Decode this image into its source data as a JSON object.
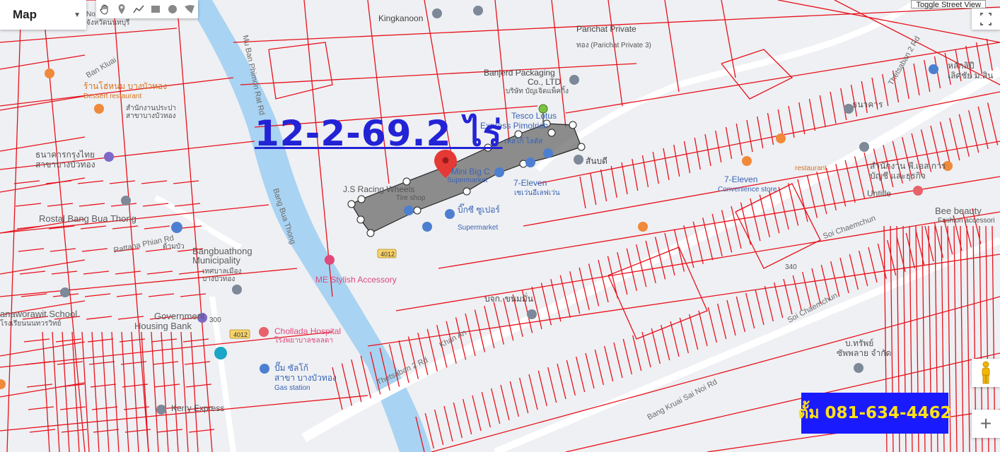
{
  "controls": {
    "map_type": "Map",
    "street_view_button": "Toggle Street View",
    "zoom_in": "+",
    "tools": [
      "hand-icon",
      "marker-icon",
      "polyline-icon",
      "rectangle-icon",
      "circle-icon",
      "polygon-icon"
    ]
  },
  "overlay": {
    "area_label": "12-2-69.2 ไร่",
    "contact": "ตั้ม 081-634-4462",
    "contact_bg": "#1a1aff",
    "contact_fg": "#ffe11a",
    "label_color": "#2323d6"
  },
  "colors": {
    "parcel_lines": "#e8101a",
    "river": "#a9d3f2",
    "polygon_fill": "#6b6b6b"
  },
  "labels": {
    "kingkanoon": "Kingkanoon",
    "parichat": "Parichat Private",
    "parichat_sub": "ทอง (Parichat Private 3)",
    "banjerd": "Banjerd Packaging",
    "banjerd2": "Co., LTD",
    "banjerd_th": "บริษัท บัญเจิดแพ็คกิ้ง",
    "tesco": "Tesco Lotus",
    "tesco2": "Express Pimolrich",
    "tesco_th": "เทสโก้ โลตัส",
    "mini_bigc": "Mini Big C",
    "supermarket": "Supermarket",
    "js_racing": "J.S Racing Wheels",
    "tire_shop": "Tire shop",
    "seven_eleven": "7-Eleven",
    "seven_eleven_th": "เซเว่นอีเลฟเว่น",
    "seven_eleven2": "7-Eleven",
    "convenience": "Convenience store",
    "sanbadi": "สันบดี",
    "supermarket_th": "บิ๊กซี ซูเปอร์",
    "supermarket_en": "Supermarket",
    "dessert_th": "ร้านโฮ่หนม บางบัวทอง",
    "dessert_en": "Dessert restaurant",
    "office_th": "สำนักงานประปา",
    "office_th2": "สาขาบางบัวทอง",
    "bank_th": "ธนาคารกรุงไทย",
    "bank_th2": "สาขาบางบัวทอง",
    "rostal": "Rostal Bang Bua Thong",
    "municipality": "Bangbuathong",
    "municipality2": "Municipality",
    "municipality_th": "เทศบาลเมือง",
    "municipality_th2": "บางบัวทอง",
    "school": "anaworawit School",
    "school_th": "โรงเรียนนนทวรวิทย์",
    "housing": "Government",
    "housing2": "Housing Bank",
    "hospital": "Chollada Hospital",
    "hospital_th": "โรงพยาบาลชลลดา",
    "gas_th": "ปั๊ม ซัลโก้",
    "gas_th2": "สาขา บางบัวทอง",
    "gas_en": "Gas station",
    "kerry": "Kerry Express",
    "stylish": "ME Stylish Accessory",
    "bangplop": "บจก. ขนมมั่น",
    "ban_kluai": "Ban Kluai",
    "nonthaburi": "จังหวัดนนทบุรี",
    "nonthaburi_top": "No",
    "soi_chae": "Soi Chaemchun",
    "accountant_th": "สำนักงาน พี.เอส.การ",
    "accountant_th2": "บัญชี และธุรกิจ",
    "untitle": "Untitle",
    "bee": "Bee beauty",
    "bee2": "Fashion accessori",
    "restaurant": "restaurant",
    "lotus_right": "หลักลิปี",
    "lotus_right2": "เลิศชัย ม.สิน",
    "bangkok_th": "ธนาคาร",
    "thaigas": "บ.ทรัพย์",
    "thaigas2": "ซัพพลาย จำกัด",
    "road_bangbua": "Bang Bua Thong",
    "road_rattana": "Rattana Phian Rd",
    "road_khan": "Khan An",
    "road_thetsaban": "Thetsaban 2 Rd",
    "road_4012": "4012",
    "road_4012b": "4012",
    "road_mu_ban": "Mu Ban Phimon Rat Rd",
    "road_taling": "Thetsaban 2 Rd",
    "road_soi_phatthana": "Soi Chaemchun",
    "road_thana": "Bang Kruai Sai Noi Rd",
    "dum": "ด้ามบัว",
    "p200": "300",
    "p340": "340"
  }
}
